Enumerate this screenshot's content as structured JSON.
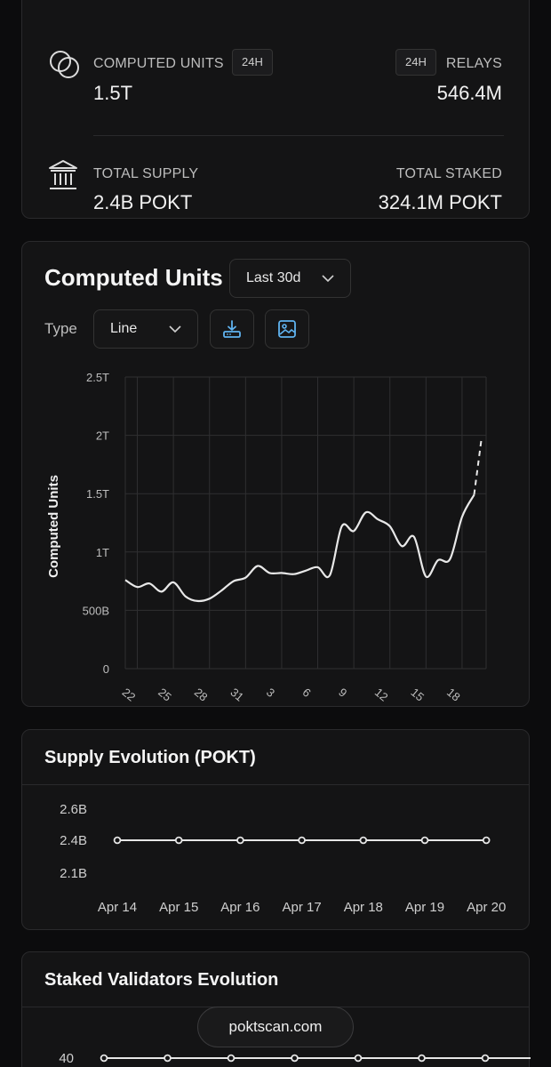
{
  "stats": {
    "computed_units": {
      "label": "COMPUTED UNITS",
      "period": "24H",
      "value": "1.5T",
      "icon": "circles-icon"
    },
    "relays": {
      "label": "RELAYS",
      "period": "24H",
      "value": "546.4M"
    },
    "total_supply": {
      "label": "TOTAL SUPPLY",
      "value": "2.4B POKT",
      "icon": "bank-icon"
    },
    "total_staked": {
      "label": "TOTAL STAKED",
      "value": "324.1M POKT"
    }
  },
  "computed_units_chart": {
    "title": "Computed Units",
    "range_select": "Last 30d",
    "type_label": "Type",
    "type_select": "Line",
    "download_icon": "download-icon",
    "image_icon": "image-icon"
  },
  "chart_data": [
    {
      "type": "line",
      "ylabel": "Computed Units",
      "xlabel": "",
      "x_tick_labels": [
        "22",
        "25",
        "28",
        "31",
        "3",
        "6",
        "9",
        "12",
        "15",
        "18"
      ],
      "y_tick_labels": [
        "0",
        "500B",
        "1T",
        "1.5T",
        "2T",
        "2.5T"
      ],
      "ylim": [
        0,
        2.5
      ],
      "y_unit": "T",
      "grid": true,
      "x": [
        21,
        22,
        23,
        24,
        25,
        26,
        27,
        28,
        29,
        30,
        31,
        32,
        33,
        34,
        35,
        36,
        37,
        38,
        39,
        40,
        41,
        42,
        43,
        44,
        45,
        46,
        47,
        48,
        49,
        50
      ],
      "values": [
        0.76,
        0.7,
        0.73,
        0.66,
        0.74,
        0.62,
        0.58,
        0.6,
        0.67,
        0.75,
        0.78,
        0.88,
        0.82,
        0.82,
        0.81,
        0.84,
        0.87,
        0.8,
        1.22,
        1.18,
        1.34,
        1.28,
        1.22,
        1.05,
        1.13,
        0.79,
        0.93,
        0.94,
        1.3,
        1.49
      ],
      "projection": {
        "x": [
          50,
          50.6
        ],
        "values": [
          1.49,
          1.96
        ],
        "style": "dashed"
      }
    },
    {
      "type": "line",
      "title": "Supply Evolution (POKT)",
      "categories": [
        "Apr 14",
        "Apr 15",
        "Apr 16",
        "Apr 17",
        "Apr 18",
        "Apr 19",
        "Apr 20"
      ],
      "y_tick_labels": [
        "2.1B",
        "2.4B",
        "2.6B"
      ],
      "values": [
        2.4,
        2.4,
        2.4,
        2.4,
        2.4,
        2.4,
        2.4
      ]
    },
    {
      "type": "line",
      "title": "Staked Validators Evolution",
      "y_tick_labels": [
        "40"
      ],
      "values": [
        40,
        40,
        40,
        40,
        40,
        40,
        40,
        40,
        40,
        40
      ]
    }
  ],
  "watermark": "poktscan.com",
  "colors": {
    "background": "#0c0c0d",
    "card": "#141415",
    "accent_icon": "#5fb3f0",
    "line": "#e8e8e8"
  }
}
